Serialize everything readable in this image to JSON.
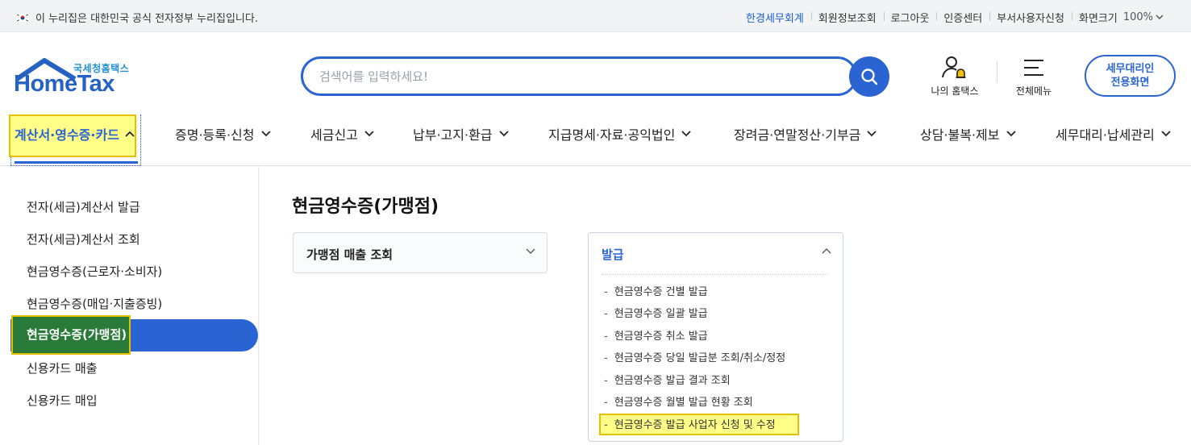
{
  "topbar": {
    "gov_notice": "이 누리집은 대한민국 공식 전자정부 누리집입니다.",
    "links": [
      "한경세무회계",
      "회원정보조회",
      "로그아웃",
      "인증센터",
      "부서사용자신청"
    ],
    "zoom_label": "화면크기",
    "zoom_value": "100%"
  },
  "header": {
    "logo_sub": "국세청홈택스",
    "logo_main": "HomeTax",
    "search_placeholder": "검색어를 입력하세요!",
    "my_hometax": "나의 홈택스",
    "all_menu": "전체메뉴",
    "agent_btn_line1": "세무대리인",
    "agent_btn_line2": "전용화면"
  },
  "gnb": {
    "items": [
      "계산서·영수증·카드",
      "증명·등록·신청",
      "세금신고",
      "납부·고지·환급",
      "지급명세·자료·공익법인",
      "장려금·연말정산·기부금",
      "상담·불복·제보",
      "세무대리·납세관리"
    ],
    "active_index": 0
  },
  "side_menu": {
    "items": [
      "전자(세금)계산서 발급",
      "전자(세금)계산서 조회",
      "현금영수증(근로자·소비자)",
      "현금영수증(매입·지출증빙)",
      "현금영수증(가맹점)",
      "신용카드 매출",
      "신용카드 매입"
    ],
    "active_index": 4
  },
  "content": {
    "page_title": "현금영수증(가맹점)",
    "accordion_collapsed": "가맹점 매출 조회",
    "accordion_expanded": {
      "title": "발급",
      "items": [
        "현금영수증 건별 발급",
        "현금영수증 일괄 발급",
        "현금영수증 취소 발급",
        "현금영수증 당일 발급분 조회/취소/정정",
        "현금영수증 발급 결과 조회",
        "현금영수증 월별 발급 현황 조회",
        "현금영수증 발급 사업자 신청 및 수정"
      ],
      "highlighted_index": 6
    }
  },
  "colors": {
    "accent": "#2a64d3",
    "highlight": "#ffff88",
    "highlight_border": "#e6c000",
    "active_side_fill": "#2a7a3a"
  }
}
